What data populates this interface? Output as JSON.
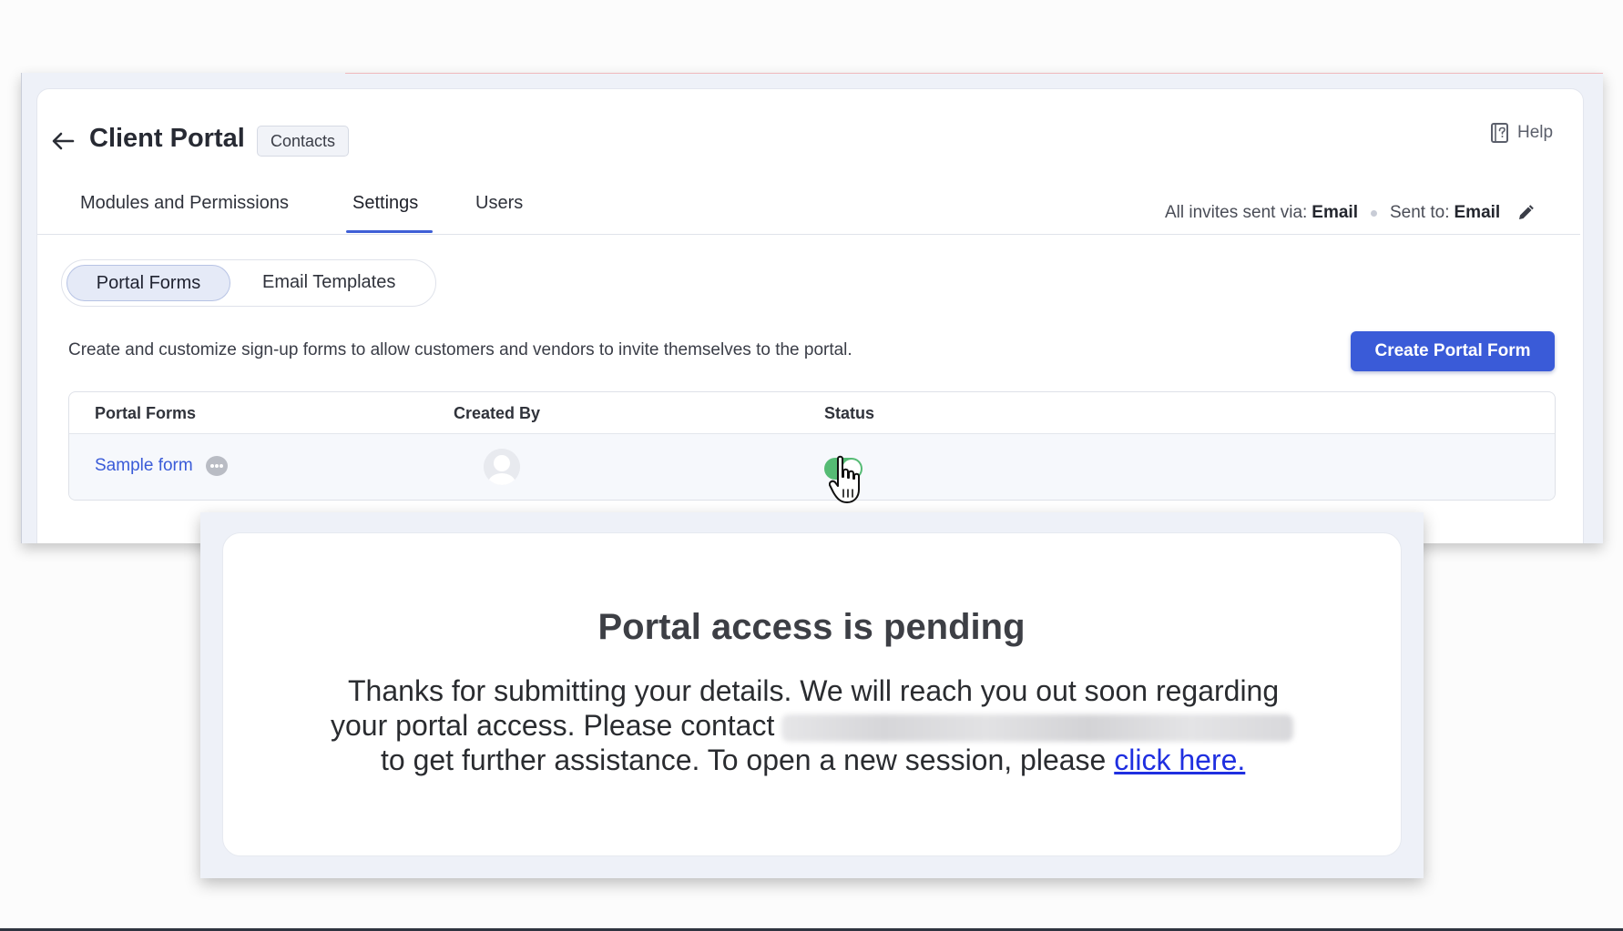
{
  "header": {
    "title": "Client Portal",
    "module_badge": "Contacts",
    "help_label": "Help"
  },
  "tabs": [
    {
      "label": "Modules and Permissions",
      "active": false
    },
    {
      "label": "Settings",
      "active": true
    },
    {
      "label": "Users",
      "active": false
    }
  ],
  "invites": {
    "via_label": "All invites sent via:",
    "via_value": "Email",
    "sent_to_label": "Sent to:",
    "sent_to_value": "Email"
  },
  "segments": [
    {
      "label": "Portal Forms",
      "active": true
    },
    {
      "label": "Email Templates",
      "active": false
    }
  ],
  "description": "Create and customize sign-up forms to allow customers and vendors to invite themselves to the portal.",
  "create_button_label": "Create Portal Form",
  "table": {
    "columns": [
      "Portal Forms",
      "Created By",
      "Status"
    ],
    "rows": [
      {
        "form_name": "Sample form",
        "status_enabled": true
      }
    ]
  },
  "notice": {
    "title": "Portal access is pending",
    "line1": "Thanks for submitting your details. We will reach you out soon regarding",
    "line2": "your portal access. Please contact",
    "line3": "to get further assistance. To open a new session, please",
    "link_text": "click here."
  },
  "colors": {
    "accent": "#3a5bd8",
    "toggle_on": "#55bb74",
    "link": "#1f2fe0"
  },
  "icons": [
    "back-arrow-icon",
    "help-book-icon",
    "pencil-edit-icon",
    "more-options-icon",
    "user-avatar-icon",
    "hand-pointer-cursor-icon"
  ]
}
